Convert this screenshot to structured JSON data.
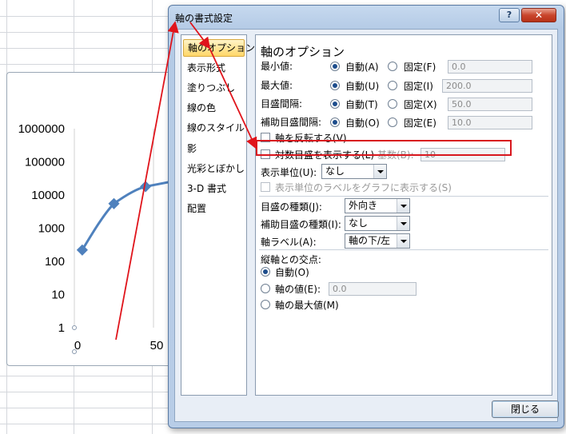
{
  "dialog": {
    "title": "軸の書式設定",
    "help_label": "?",
    "close_x_label": "✕",
    "close_button_label": "閉じる"
  },
  "categories": [
    {
      "label": "軸のオプション",
      "selected": true
    },
    {
      "label": "表示形式",
      "selected": false
    },
    {
      "label": "塗りつぶし",
      "selected": false
    },
    {
      "label": "線の色",
      "selected": false
    },
    {
      "label": "線のスタイル",
      "selected": false
    },
    {
      "label": "影",
      "selected": false
    },
    {
      "label": "光彩とぼかし",
      "selected": false
    },
    {
      "label": "3-D 書式",
      "selected": false
    },
    {
      "label": "配置",
      "selected": false
    }
  ],
  "options": {
    "heading": "軸のオプション",
    "rows": [
      {
        "label": "最小値:",
        "auto_label": "自動(A)",
        "fixed_label": "固定(F)",
        "value": "0.0",
        "selected": "auto"
      },
      {
        "label": "最大値:",
        "auto_label": "自動(U)",
        "fixed_label": "固定(I)",
        "value": "200.0",
        "selected": "auto"
      },
      {
        "label": "目盛間隔:",
        "auto_label": "自動(T)",
        "fixed_label": "固定(X)",
        "value": "50.0",
        "selected": "auto"
      },
      {
        "label": "補助目盛間隔:",
        "auto_label": "自動(O)",
        "fixed_label": "固定(E)",
        "value": "10.0",
        "selected": "auto"
      }
    ],
    "reverse_label": "軸を反転する(V)",
    "log_scale_label": "対数目盛を表示する(L)",
    "base_label": "基数(B):",
    "base_value": "10",
    "display_unit_label": "表示単位(U):",
    "display_unit_value": "なし",
    "show_unit_label": "表示単位のラベルをグラフに表示する(S)",
    "major_tick_label": "目盛の種類(J):",
    "major_tick_value": "外向き",
    "minor_tick_label": "補助目盛の種類(I):",
    "minor_tick_value": "なし",
    "axis_label_label": "軸ラベル(A):",
    "axis_label_value": "軸の下/左",
    "cross_heading": "縦軸との交点:",
    "cross_auto_label": "自動(O)",
    "cross_value_label": "軸の値(E):",
    "cross_value": "0.0",
    "cross_max_label": "軸の最大値(M)",
    "cross_selected": "auto"
  },
  "chart_data": {
    "type": "line",
    "y_tick_labels": [
      "1000000",
      "100000",
      "10000",
      "1000",
      "100",
      "10",
      "1"
    ],
    "x_tick_labels": [
      "0",
      "50"
    ],
    "x": [
      5,
      25,
      45
    ],
    "y": [
      220,
      5500,
      18000
    ],
    "y_scale": "log",
    "series_color": "#4f81bd"
  },
  "colors": {
    "highlight": "#d8171e",
    "arrow": "#e0141b",
    "selected_category": "#ffd769"
  }
}
